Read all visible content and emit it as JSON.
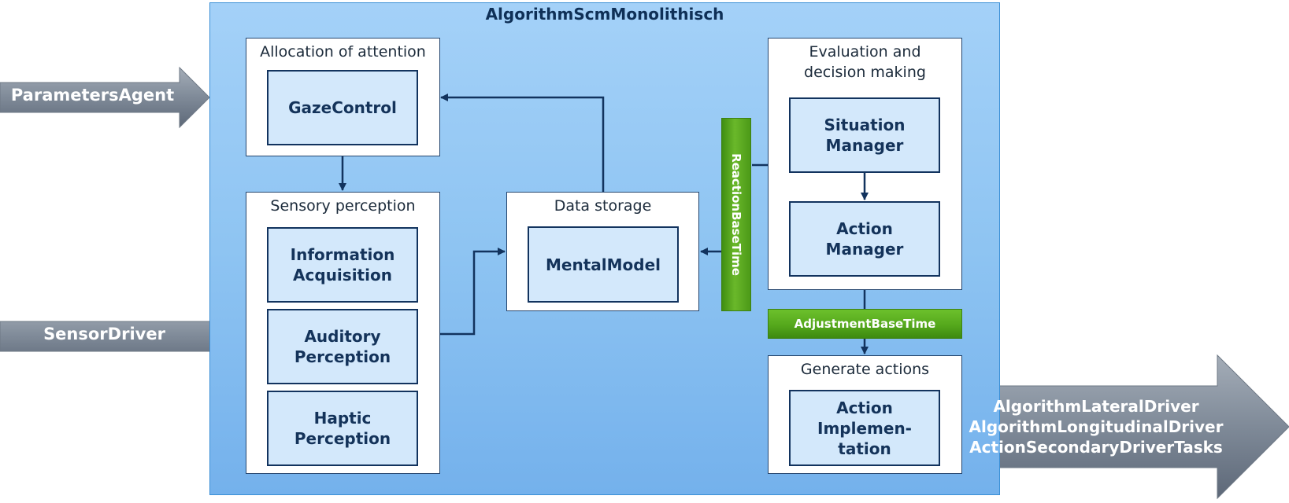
{
  "diagram": {
    "title": "AlgorithmScmMonolithisch",
    "inputs": [
      {
        "id": "parameters-agent",
        "label": "ParametersAgent"
      },
      {
        "id": "sensor-driver",
        "label": "SensorDriver"
      }
    ],
    "output": {
      "lines": [
        "AlgorithmLateralDriver",
        "AlgorithmLongitudinalDriver",
        "ActionSecondaryDriverTasks"
      ]
    },
    "groups": {
      "attention": {
        "title": "Allocation of attention",
        "components": [
          "GazeControl"
        ]
      },
      "perception": {
        "title": "Sensory perception",
        "components": [
          "Information\nAcquisition",
          "Auditory\nPerception",
          "Haptic\nPerception"
        ]
      },
      "storage": {
        "title": "Data storage",
        "components": [
          "MentalModel"
        ]
      },
      "evaluation": {
        "title": "Evaluation and\ndecision making",
        "components": [
          "Situation\nManager",
          "Action\nManager"
        ]
      },
      "generate": {
        "title": "Generate actions",
        "components": [
          "Action\nImplemen-\ntation"
        ]
      }
    },
    "timing": {
      "reaction": "ReactionBaseTime",
      "adjustment": "AdjustmentBaseTime"
    },
    "colors": {
      "frame": "#8ec4f2",
      "component_fill": "#d3e8fb",
      "component_border": "#12335e",
      "timing_green": "#5aab1e",
      "io_arrow": "#7d8896",
      "connector": "#12335e"
    }
  }
}
